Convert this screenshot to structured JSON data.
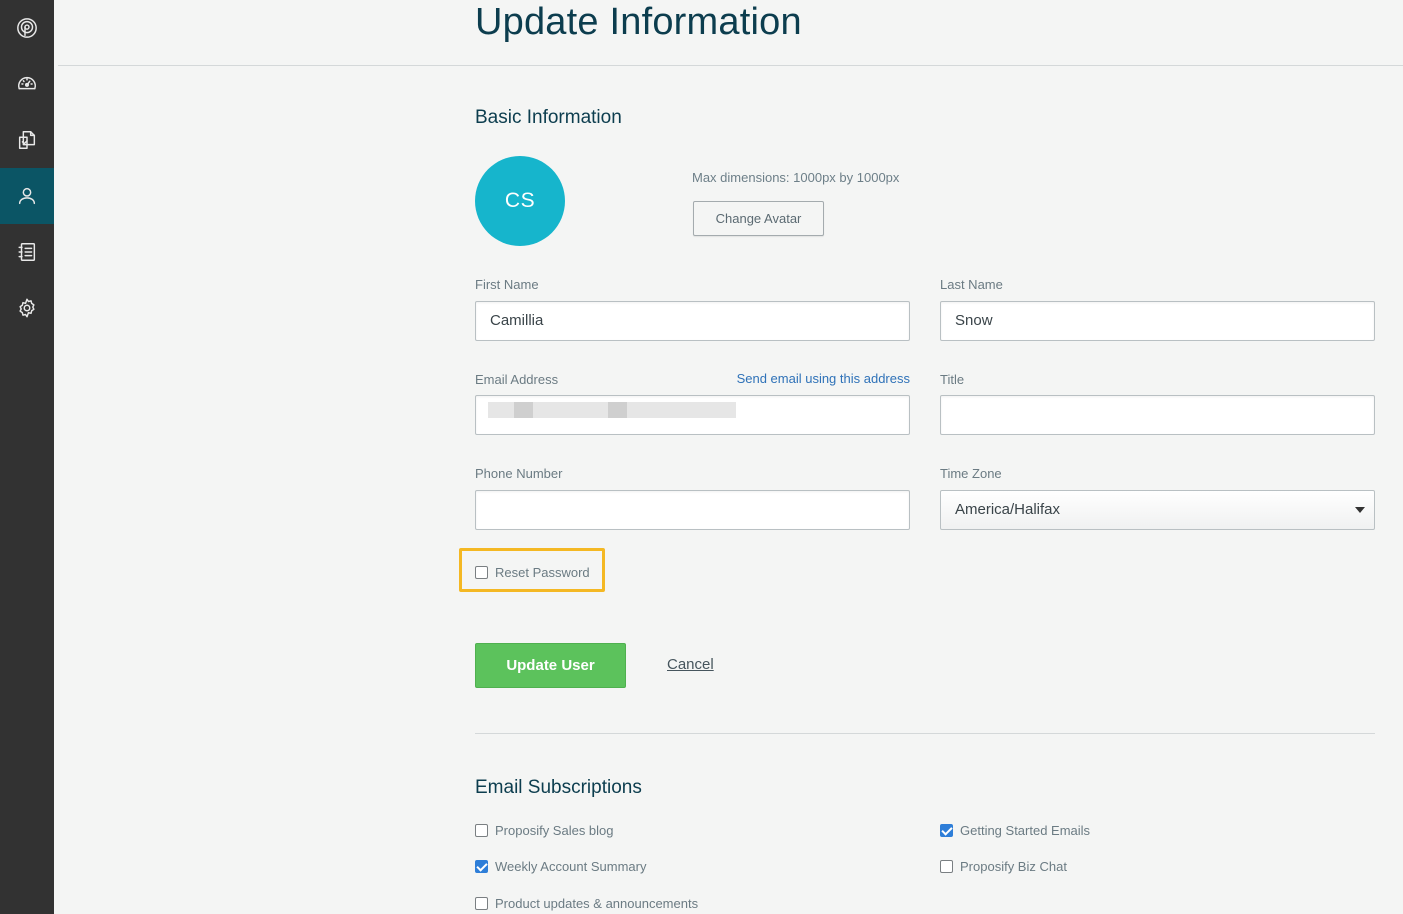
{
  "sidebar": {
    "items": [
      {
        "icon": "proposify-logo-icon"
      },
      {
        "icon": "dashboard-gauge-icon"
      },
      {
        "icon": "documents-icon"
      },
      {
        "icon": "user-icon",
        "active": true
      },
      {
        "icon": "notebook-icon"
      },
      {
        "icon": "gear-icon"
      }
    ]
  },
  "header": {
    "title": "Update Information"
  },
  "basic": {
    "title": "Basic Information",
    "avatar_initials": "CS",
    "avatar_color": "#16b5cc",
    "avatar_hint": "Max dimensions: 1000px by 1000px",
    "change_avatar_label": "Change Avatar"
  },
  "form": {
    "first_name_label": "First Name",
    "first_name_value": "Camillia",
    "last_name_label": "Last Name",
    "last_name_value": "Snow",
    "email_label": "Email Address",
    "send_email_link": "Send email using this address",
    "title_label": "Title",
    "title_value": "",
    "phone_label": "Phone Number",
    "phone_value": "",
    "timezone_label": "Time Zone",
    "timezone_value": "America/Halifax",
    "reset_password_label": "Reset Password",
    "reset_password_checked": false
  },
  "actions": {
    "update_label": "Update User",
    "cancel_label": "Cancel",
    "accent_green": "#5cc25c",
    "highlight_color": "#f4b823"
  },
  "subscriptions": {
    "title": "Email Subscriptions",
    "items": [
      {
        "label": "Proposify Sales blog",
        "checked": false
      },
      {
        "label": "Getting Started Emails",
        "checked": true
      },
      {
        "label": "Weekly Account Summary",
        "checked": true
      },
      {
        "label": "Proposify Biz Chat",
        "checked": false
      },
      {
        "label": "Product updates & announcements",
        "checked": false
      }
    ]
  }
}
